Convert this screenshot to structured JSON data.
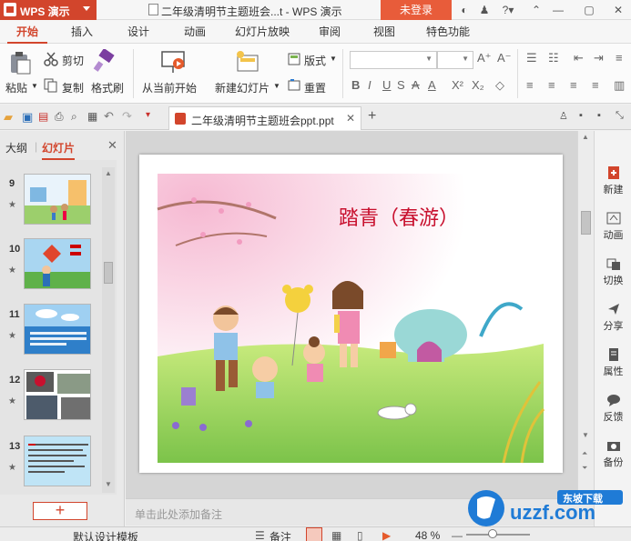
{
  "titlebar": {
    "app_name": "WPS 演示",
    "doc_title": "二年级清明节主题班会...t - WPS 演示",
    "login_label": "未登录"
  },
  "menu": {
    "tabs": [
      "开始",
      "插入",
      "设计",
      "动画",
      "幻灯片放映",
      "审阅",
      "视图",
      "特色功能"
    ],
    "active": "开始"
  },
  "ribbon": {
    "paste": "粘贴",
    "cut": "剪切",
    "copy": "复制",
    "format_painter": "格式刷",
    "from_current": "从当前开始",
    "new_slide": "新建幻灯片",
    "layout": "版式",
    "reset": "重置"
  },
  "doctab": {
    "name": "二年级清明节主题班会ppt.ppt"
  },
  "leftpane": {
    "tab_outline": "大纲",
    "tab_slides": "幻灯片",
    "thumbs": [
      {
        "num": "9"
      },
      {
        "num": "10"
      },
      {
        "num": "11"
      },
      {
        "num": "12"
      },
      {
        "num": "13"
      }
    ],
    "add_label": "+"
  },
  "slide": {
    "title": "踏青（春游）"
  },
  "notes_placeholder": "单击此处添加备注",
  "rightpane": {
    "items": [
      "新建",
      "动画",
      "切换",
      "分享",
      "属性",
      "反馈",
      "备份"
    ]
  },
  "statusbar": {
    "template": "默认设计模板",
    "notes": "备注",
    "zoom": "48 %"
  },
  "watermark": {
    "text": "uzzf.com",
    "badge": "东坡下载"
  },
  "colors": {
    "accent": "#d2452c",
    "slide_title": "#c8102e"
  }
}
